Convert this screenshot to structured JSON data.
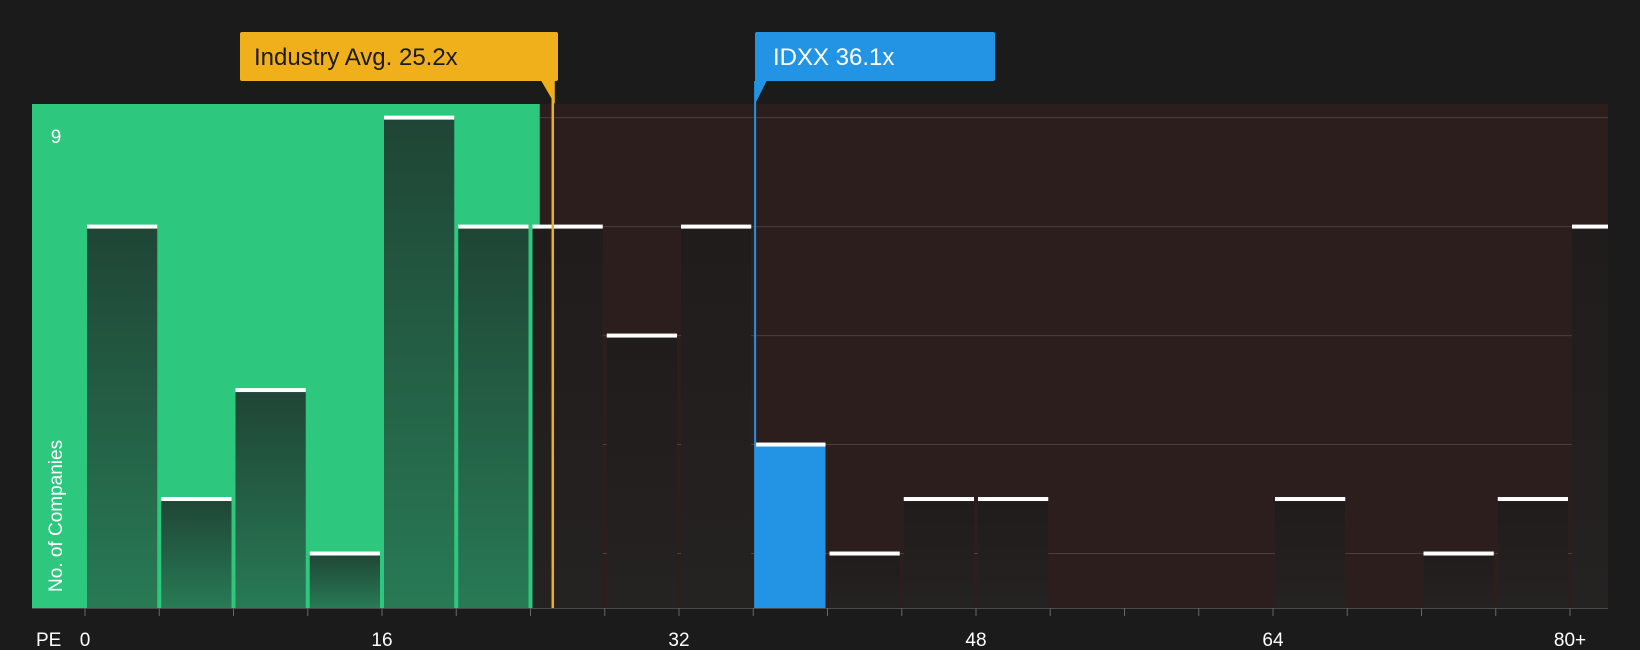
{
  "chart_data": {
    "type": "bar",
    "title": "",
    "xlabel": "PE",
    "ylabel": "No. of Companies",
    "x_range": [
      0,
      82
    ],
    "ylim": [
      0,
      9.25
    ],
    "y_ticks": [
      {
        "value": 9,
        "label": "9"
      }
    ],
    "x_ticks": [
      {
        "value": 0,
        "label": "0"
      },
      {
        "value": 16,
        "label": "16"
      },
      {
        "value": 32,
        "label": "32"
      },
      {
        "value": 48,
        "label": "48"
      },
      {
        "value": 64,
        "label": "64"
      },
      {
        "value": 80,
        "label": "80+"
      }
    ],
    "bin_edges": [
      0,
      4,
      8,
      12,
      16,
      20,
      24,
      28,
      32,
      36,
      40,
      44,
      48,
      52,
      56,
      60,
      64,
      68,
      72,
      76,
      80
    ],
    "bins": [
      {
        "x": 2,
        "value": 7
      },
      {
        "x": 6,
        "value": 2
      },
      {
        "x": 10,
        "value": 4
      },
      {
        "x": 14,
        "value": 1
      },
      {
        "x": 18,
        "value": 9
      },
      {
        "x": 22,
        "value": 7
      },
      {
        "x": 26,
        "value": 7
      },
      {
        "x": 30,
        "value": 5
      },
      {
        "x": 34,
        "value": 7
      },
      {
        "x": 38,
        "value": 3,
        "highlight": true
      },
      {
        "x": 42,
        "value": 1
      },
      {
        "x": 46,
        "value": 2
      },
      {
        "x": 50,
        "value": 2
      },
      {
        "x": 66,
        "value": 2
      },
      {
        "x": 74,
        "value": 1
      },
      {
        "x": 78,
        "value": 2
      },
      {
        "x": 82,
        "value": 7
      }
    ],
    "grid": true,
    "below_average_region": {
      "from": 0,
      "to": 24.5
    },
    "markers": [
      {
        "id": "industry",
        "label": "Industry Avg. 25.2x",
        "value": 25.2,
        "color": "#f0b01c",
        "text_color": "#1b1b1b"
      },
      {
        "id": "company",
        "label": "IDXX 36.1x",
        "value": 36.1,
        "color": "#2394e3",
        "text_color": "#ffffff"
      }
    ]
  },
  "colors": {
    "background": "#1b1b1b",
    "below_region": "#2dc77e",
    "above_region": "#2d1e1e",
    "bar_in_green": "#1f4535",
    "bar_dark": "#222020",
    "highlight_bar": "#2394e3",
    "cap": "#ffffff",
    "grid": "#4b3f3f"
  }
}
